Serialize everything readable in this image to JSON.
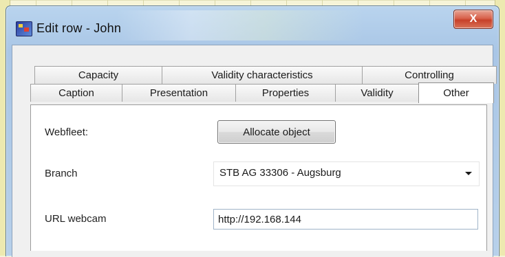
{
  "window": {
    "title": "Edit row - John",
    "close_glyph": "X",
    "app_icon": "app-logo-icon"
  },
  "tabs": {
    "back_row": [
      "Capacity",
      "Validity characteristics",
      "Controlling"
    ],
    "front_row": [
      "Caption",
      "Presentation",
      "Properties",
      "Validity",
      "Other"
    ],
    "active": "Other"
  },
  "form": {
    "webfleet_label": "Webfleet:",
    "allocate_button": "Allocate object",
    "branch_label": "Branch",
    "branch_value": "STB AG 33306 - Augsburg",
    "url_label": "URL webcam",
    "url_value": "http://192.168.144"
  },
  "colors": {
    "titlebar": "#b9d4ee",
    "close_button": "#c7412a",
    "background_app": "#f6f4d8"
  }
}
